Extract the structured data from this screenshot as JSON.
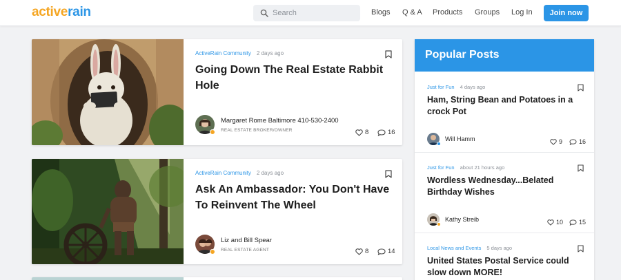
{
  "brand": {
    "part1": "active",
    "part2": "rain"
  },
  "search": {
    "placeholder": "Search"
  },
  "nav": {
    "blogs": "Blogs",
    "qa": "Q & A",
    "products": "Products",
    "groups": "Groups",
    "login": "Log In",
    "join": "Join now"
  },
  "posts": [
    {
      "category": "ActiveRain Community",
      "ago": "2 days ago",
      "title": "Going Down The Real Estate Rabbit Hole",
      "author": "Margaret Rome Baltimore 410-530-2400",
      "role": "REAL ESTATE BROKER/OWNER",
      "likes": "8",
      "comments": "16"
    },
    {
      "category": "ActiveRain Community",
      "ago": "2 days ago",
      "title": "Ask An Ambassador: You Don't Have To Reinvent The Wheel",
      "author": "Liz and Bill Spear",
      "role": "REAL ESTATE AGENT",
      "likes": "8",
      "comments": "14"
    }
  ],
  "popular": {
    "heading": "Popular Posts",
    "items": [
      {
        "category": "Just for Fun",
        "ago": "4 days ago",
        "title": "Ham, String Bean and Potatoes in a crock Pot",
        "author": "Will Hamm",
        "likes": "9",
        "comments": "16"
      },
      {
        "category": "Just for Fun",
        "ago": "about 21 hours ago",
        "title": "Wordless Wednesday...Belated Birthday Wishes",
        "author": "Kathy Streib",
        "likes": "10",
        "comments": "15"
      },
      {
        "category": "Local News and Events",
        "ago": "5 days ago",
        "title": "United States Postal Service could slow down MORE!"
      }
    ]
  },
  "colors": {
    "accent": "#2b95e6",
    "logo_orange": "#f5a623",
    "background": "#f1f2f4"
  }
}
